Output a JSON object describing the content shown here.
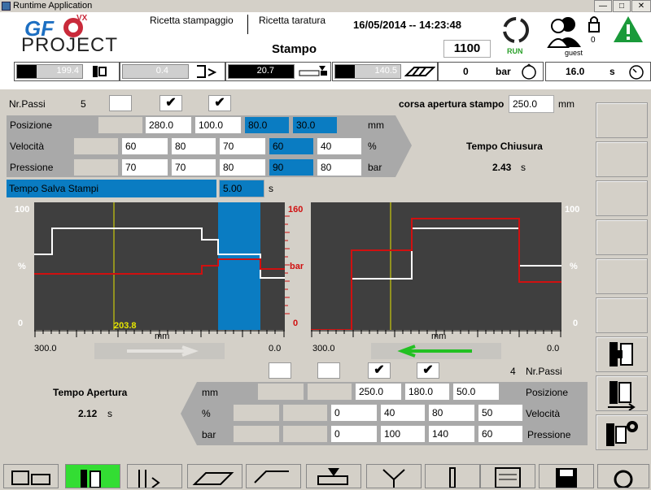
{
  "window": {
    "title": "Runtime Application",
    "btn_min": "—",
    "btn_max": "□",
    "btn_close": "✕"
  },
  "header": {
    "logo_gf": "GF",
    "logo_vx": "VX",
    "logo_project": "PROJECT",
    "menu1": "Ricetta stampaggio",
    "menu2": "Ricetta taratura",
    "datetime": "16/05/2014 -- 14:23:48",
    "mould_label": "Stampo",
    "mould_value": "1100",
    "run_label": "RUN",
    "lock_count": "0",
    "user": "guest",
    "gauges": [
      {
        "value": "199.4",
        "icon": "clamp-icon",
        "fill": 0.3
      },
      {
        "value": "0.4",
        "icon": "ejector-icon",
        "fill": 0.0
      },
      {
        "value": "20.7",
        "icon": "injection-icon",
        "fill": 1.0
      },
      {
        "value": "140.5",
        "icon": "screw-icon",
        "fill": 0.3
      }
    ],
    "pressure_value": "0",
    "pressure_unit": "bar",
    "time_value": "16.0",
    "time_unit": "s"
  },
  "closing": {
    "nr_passi_label": "Nr.Passi",
    "nr_passi_value": "5",
    "corsa_label": "corsa apertura stampo",
    "corsa_value": "250.0",
    "corsa_unit": "mm",
    "pos_label": "Posizione",
    "pos_values": [
      "",
      "280.0",
      "100.0",
      "80.0",
      "30.0"
    ],
    "pos_unit": "mm",
    "vel_label": "Velocità",
    "vel_values": [
      "",
      "60",
      "80",
      "70",
      "60",
      "40"
    ],
    "vel_unit": "%",
    "pres_label": "Pressione",
    "pres_values": [
      "",
      "70",
      "70",
      "80",
      "90",
      "80"
    ],
    "pres_unit": "bar",
    "safe_label": "Tempo Salva Stampi",
    "safe_value": "5.00",
    "safe_unit": "s",
    "time_title": "Tempo Chiusura",
    "time_value": "2.43",
    "time_unit": "s",
    "checks": [
      "",
      "✔",
      "✔"
    ]
  },
  "chart_left": {
    "y_top": "100",
    "y_mid": "%",
    "y_bottom": "0",
    "r_top": "160",
    "r_mid": "bar",
    "r_bottom": "0",
    "cursor_label": "203.8",
    "x_unit": "mm",
    "x_left": "300.0",
    "x_right": "0.0"
  },
  "chart_right": {
    "y_top": "100",
    "y_mid": "%",
    "y_bottom": "0",
    "x_unit": "mm",
    "x_left": "300.0",
    "x_right": "0.0"
  },
  "opening": {
    "checks": [
      "",
      "",
      "✔",
      "✔"
    ],
    "nr_passi_value": "4",
    "nr_passi_label": "Nr.Passi",
    "time_title": "Tempo Apertura",
    "time_value": "2.12",
    "time_unit": "s",
    "mm_label": "mm",
    "pos_values": [
      "",
      "",
      "250.0",
      "180.0",
      "50.0"
    ],
    "pos_label": "Posizione",
    "pct_label": "%",
    "vel_values": [
      "",
      "",
      "0",
      "40",
      "80",
      "50"
    ],
    "vel_label": "Velocità",
    "bar_label": "bar",
    "pres_values": [
      "",
      "",
      "0",
      "100",
      "140",
      "60"
    ],
    "pres_label": "Pressione"
  },
  "colors": {
    "accent_blue": "#0a7cc2",
    "run_green": "#2aa02a",
    "alert_green": "#1a9a3a",
    "curve_red": "#d01010"
  }
}
